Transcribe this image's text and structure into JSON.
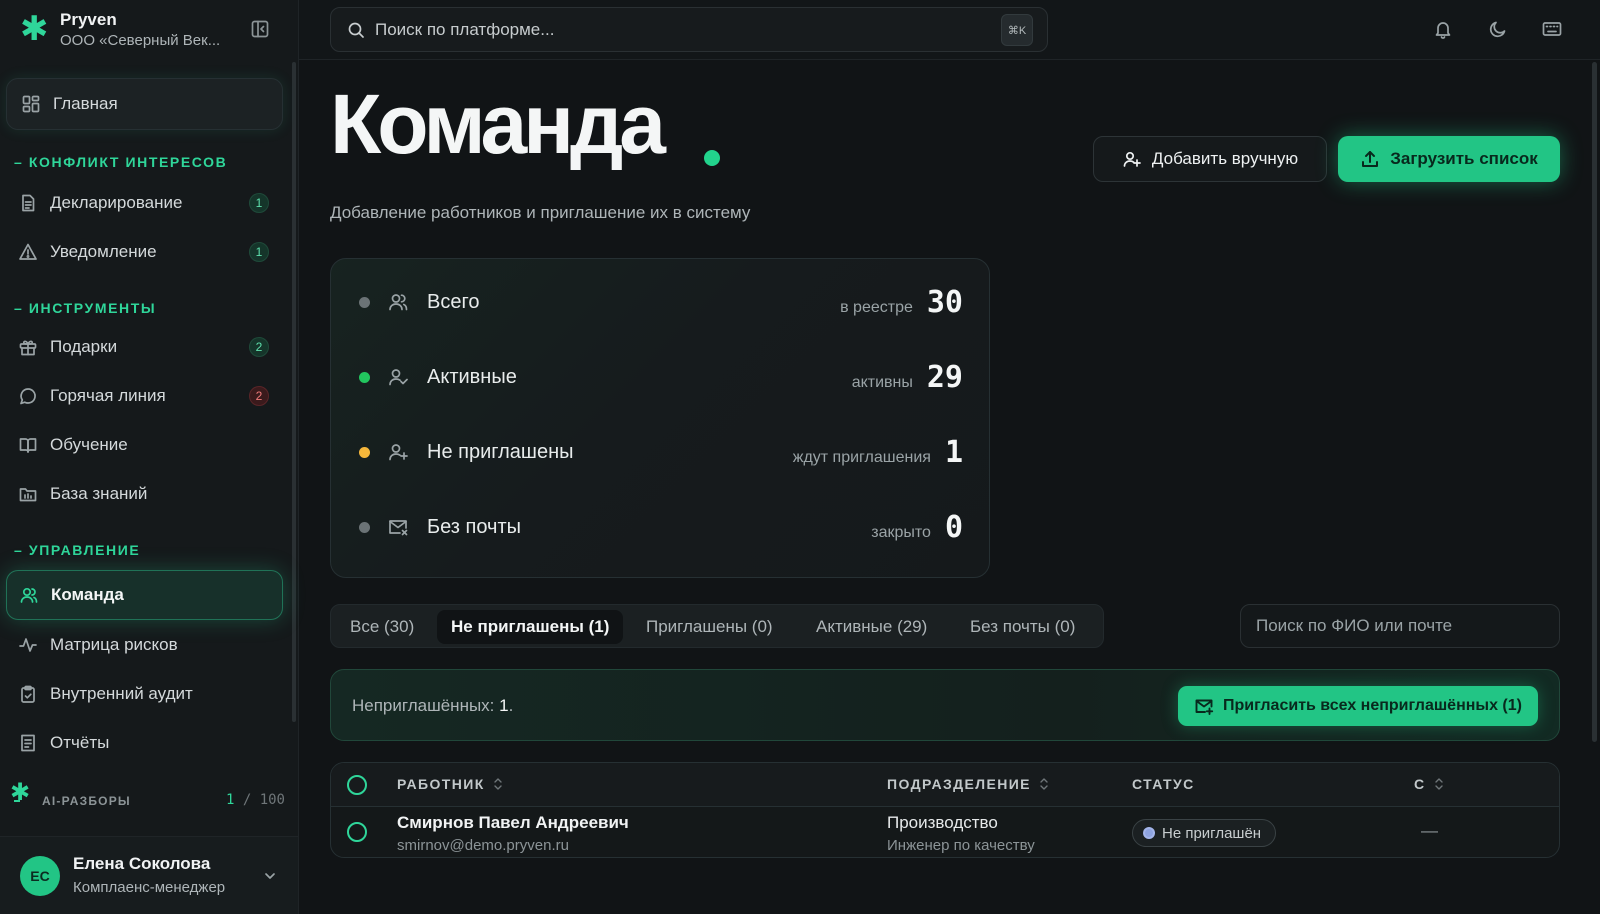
{
  "app": {
    "name": "Pryven",
    "org": "ООО «Северный Век...",
    "accent": "#22c585"
  },
  "topbar": {
    "search_placeholder": "Поиск по платформе...",
    "shortcut": "⌘K",
    "icons": [
      "bell-icon",
      "moon-icon",
      "keyboard-icon"
    ]
  },
  "sidebar": {
    "home": "Главная",
    "sections": [
      {
        "label": "КОНФЛИКТ ИНТЕРЕСОВ",
        "items": [
          {
            "label": "Декларирование",
            "badge": "1",
            "icon": "document-icon"
          },
          {
            "label": "Уведомление",
            "badge": "1",
            "icon": "warning-icon"
          }
        ]
      },
      {
        "label": "ИНСТРУМЕНТЫ",
        "items": [
          {
            "label": "Подарки",
            "badge": "2",
            "icon": "gift-icon"
          },
          {
            "label": "Горячая линия",
            "badge": "2",
            "icon": "chat-icon"
          },
          {
            "label": "Обучение",
            "icon": "book-icon"
          },
          {
            "label": "База знаний",
            "icon": "folder-icon"
          }
        ]
      },
      {
        "label": "УПРАВЛЕНИЕ",
        "items": [
          {
            "label": "Команда",
            "icon": "users-icon"
          },
          {
            "label": "Матрица рисков",
            "icon": "activity-icon"
          },
          {
            "label": "Внутренний аудит",
            "icon": "clipboard-icon"
          },
          {
            "label": "Отчёты",
            "icon": "report-icon"
          }
        ]
      }
    ],
    "ai": {
      "label": "AI-РАЗБОРЫ",
      "used": "1",
      "sep": " / ",
      "limit": "100"
    },
    "user": {
      "initials": "ЕС",
      "name": "Елена Соколова",
      "role": "Комплаенс-менеджер"
    }
  },
  "main": {
    "title": "Команда",
    "subtitle": "Добавление работников и приглашение их в систему",
    "add_manual": "Добавить вручную",
    "upload_list": "Загрузить список",
    "stats": [
      {
        "label": "Всего",
        "hint": "в реестре",
        "value": "30",
        "dot": "#6b7376",
        "icon": "users-icon"
      },
      {
        "label": "Активные",
        "hint": "активны",
        "value": "29",
        "dot": "#22c55e",
        "icon": "user-check-icon"
      },
      {
        "label": "Не приглашены",
        "hint": "ждут приглашения",
        "value": "1",
        "dot": "#f5b73b",
        "icon": "user-plus-icon"
      },
      {
        "label": "Без почты",
        "hint": "закрыто",
        "value": "0",
        "dot": "#6b7376",
        "icon": "mail-x-icon"
      }
    ],
    "tabs": [
      "Все (30)",
      "Не приглашены (1)",
      "Приглашены (0)",
      "Активные (29)",
      "Без почты (0)"
    ],
    "active_tab": 1,
    "table_search_placeholder": "Поиск по ФИО или почте",
    "invite": {
      "text_label": "Неприглашённых: ",
      "count": "1",
      "text_end": ".",
      "button": "Пригласить всех неприглашённых (1)"
    },
    "table": {
      "columns": [
        "РАБОТНИК",
        "ПОДРАЗДЕЛЕНИЕ",
        "СТАТУС",
        "С"
      ],
      "rows": [
        {
          "name": "Смирнов Павел Андреевич",
          "email": "smirnov@demo.pryven.ru",
          "dept": "Производство",
          "position": "Инженер по качеству",
          "status": "Не приглашён",
          "extra": "—"
        }
      ]
    }
  }
}
